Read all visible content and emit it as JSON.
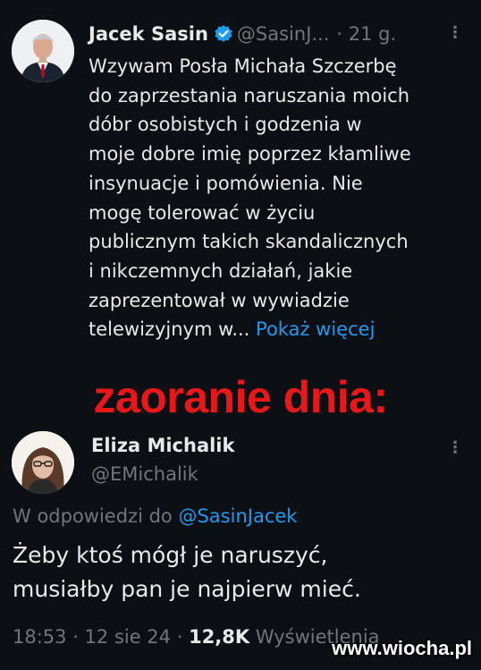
{
  "tweet": {
    "author_name": "Jacek Sasin",
    "author_handle": "@SasinJ...",
    "time": "· 21 g.",
    "more": "⋮",
    "body_lines": [
      "Wzywam Posła Michała Szczerbę",
      "do zaprzestania naruszania moich",
      "dóbr osobistych i godzenia w",
      "moje dobre imię poprzez kłamliwe",
      "insynuacje i pomówienia. Nie",
      "mogę tolerować w życiu",
      "publicznym takich skandalicznych",
      "i nikczemnych działań, jakie",
      "zaprezentował w wywiadzie"
    ],
    "last_line": "telewizyjnym w...",
    "show_more": "Pokaż więcej",
    "verified_icon": "verified-badge-icon",
    "verified_color": "#1d9bf0"
  },
  "caption": "zaoranie dnia:",
  "reply": {
    "author_name": "Eliza Michalik",
    "author_handle": "@EMichalik",
    "more": "⋮",
    "in_reply_to_prefix": "W odpowiedzi do",
    "in_reply_to_handle": "@SasinJacek",
    "body_lines": [
      "Żeby ktoś mógł je naruszyć,",
      "musiałby pan je najpierw mieć."
    ],
    "timestamp": "18:53 · 12 sie 24 ·",
    "views_count": "12,8K",
    "views_label": "Wyświetlenia"
  },
  "watermark": "www.wiocha.pl",
  "colors": {
    "background": "#0c0f13",
    "link": "#1d9bf0",
    "caption": "#e8171a",
    "muted": "#71767b"
  }
}
